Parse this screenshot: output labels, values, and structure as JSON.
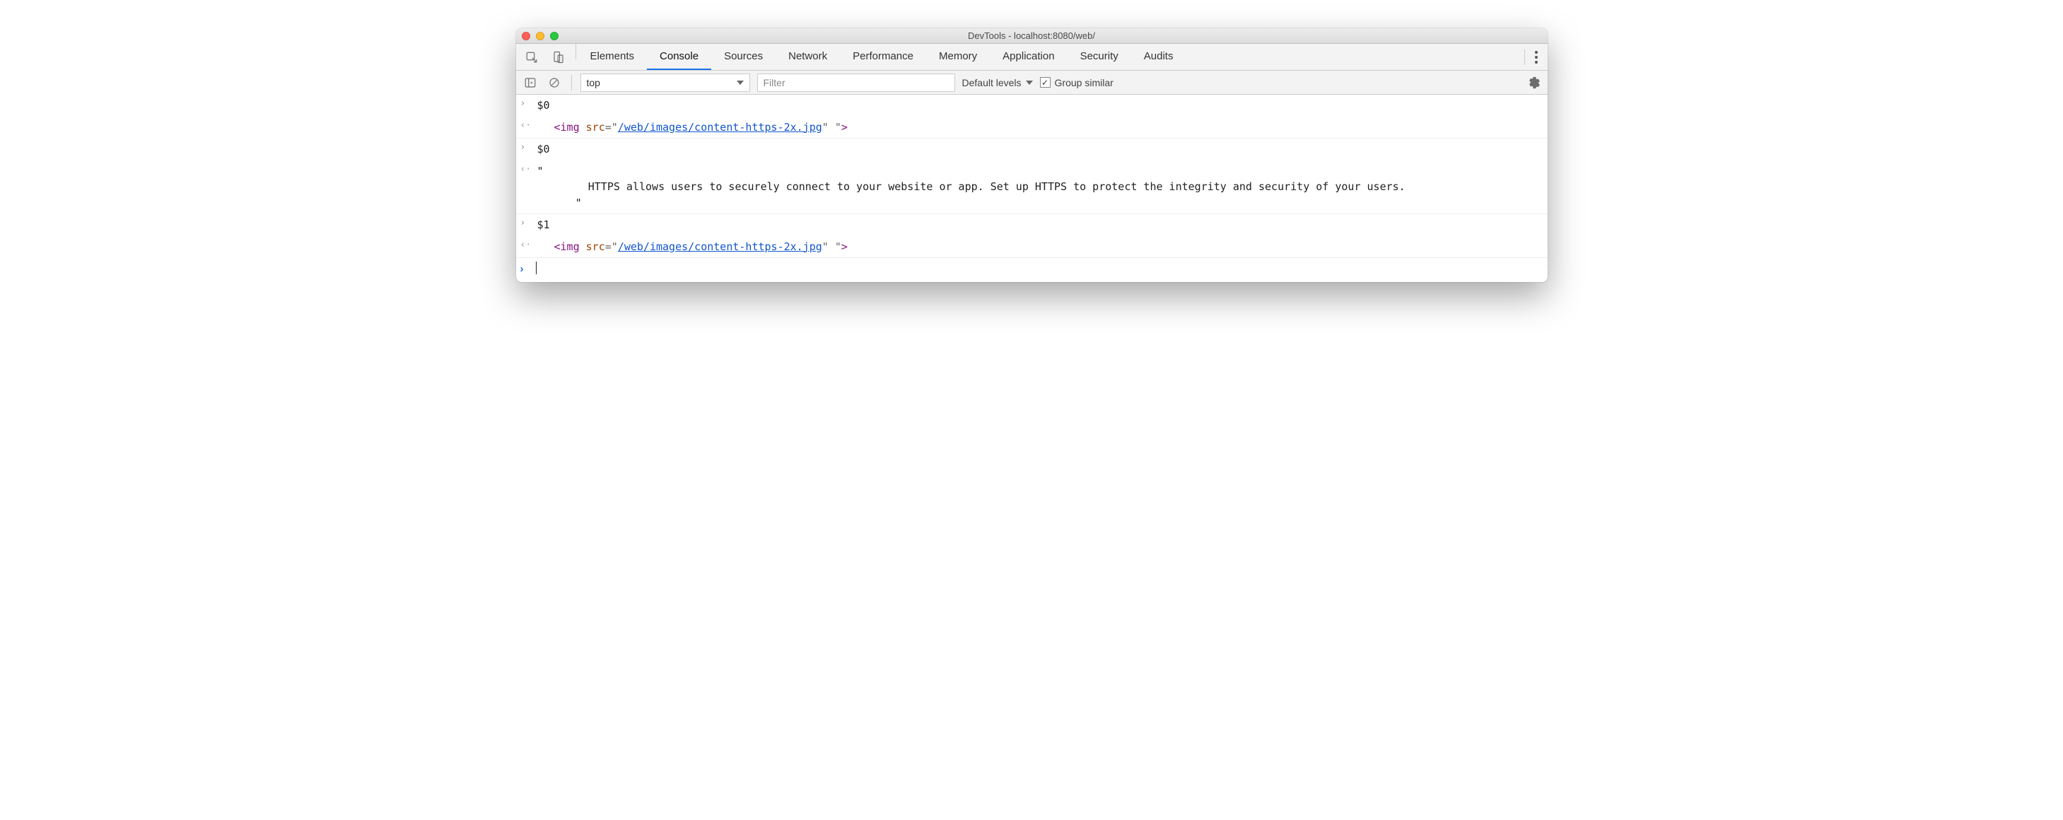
{
  "window": {
    "title": "DevTools - localhost:8080/web/"
  },
  "tabs": {
    "items": [
      {
        "label": "Elements"
      },
      {
        "label": "Console",
        "active": true
      },
      {
        "label": "Sources"
      },
      {
        "label": "Network"
      },
      {
        "label": "Performance"
      },
      {
        "label": "Memory"
      },
      {
        "label": "Application"
      },
      {
        "label": "Security"
      },
      {
        "label": "Audits"
      }
    ]
  },
  "toolbar": {
    "context": "top",
    "filter_placeholder": "Filter",
    "levels_label": "Default levels",
    "group_similar_label": "Group similar",
    "group_similar_checked": true
  },
  "console": {
    "entries": [
      {
        "type": "input",
        "text": "$0"
      },
      {
        "type": "output-html",
        "tag": "img",
        "attr": "src",
        "linkValue": "/web/images/content-https-2x.jpg",
        "trailing": " "
      },
      {
        "type": "input",
        "text": "$0"
      },
      {
        "type": "output-text",
        "text": "\"\n        HTTPS allows users to securely connect to your website or app. Set up HTTPS to protect the integrity and security of your users.\n      \""
      },
      {
        "type": "input",
        "text": "$1"
      },
      {
        "type": "output-html",
        "tag": "img",
        "attr": "src",
        "linkValue": "/web/images/content-https-2x.jpg",
        "trailing": " "
      }
    ]
  }
}
